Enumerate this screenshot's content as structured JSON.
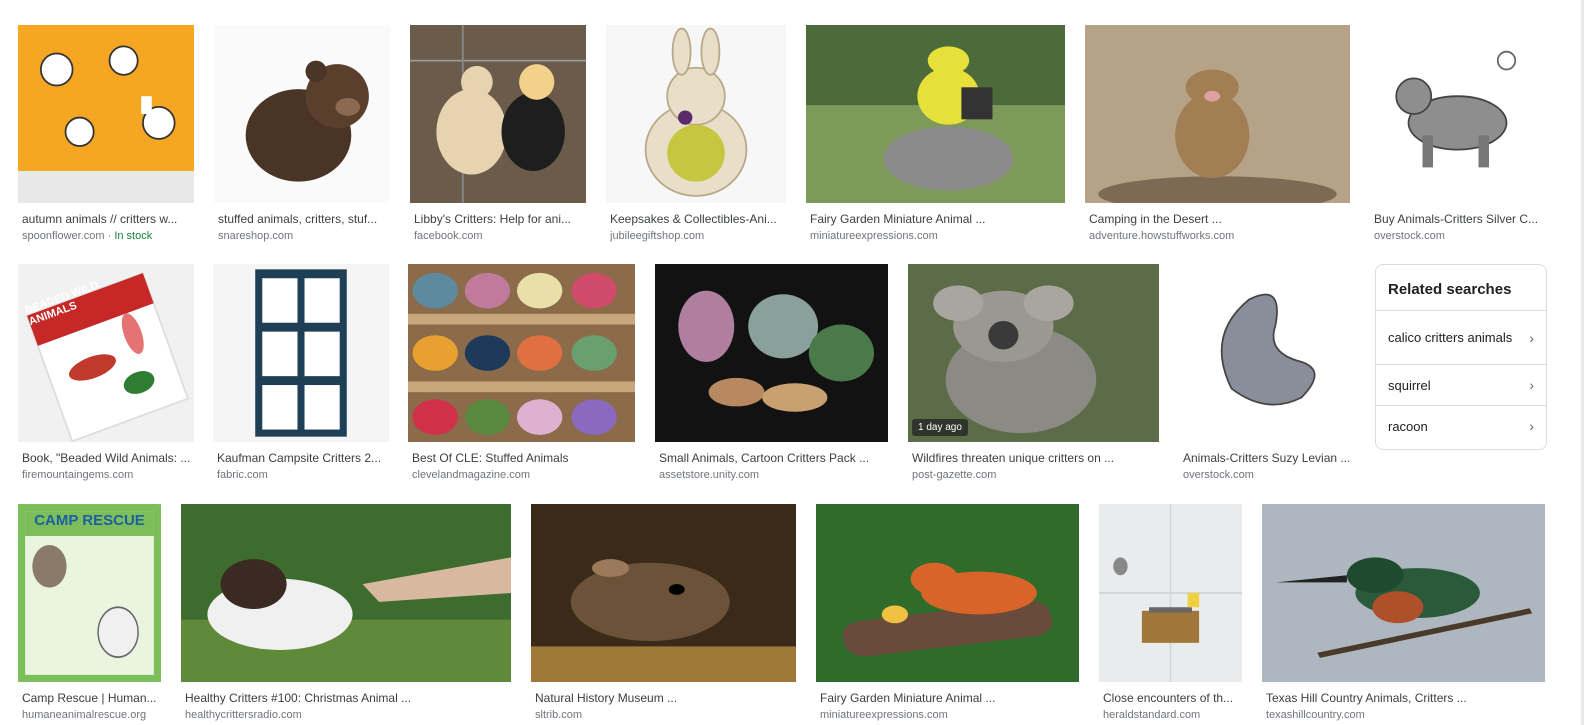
{
  "results": [
    {
      "title": "autumn animals // critters w...",
      "source": "spoonflower.com",
      "stock": "In stock",
      "badge": "",
      "icon": "wallpaper-thumbnail"
    },
    {
      "title": "stuffed animals, critters, stuf...",
      "source": "snareshop.com",
      "badge": "",
      "icon": "teddy-bear-thumbnail"
    },
    {
      "title": "Libby's Critters: Help for ani...",
      "source": "facebook.com",
      "badge": "",
      "icon": "chickens-thumbnail"
    },
    {
      "title": "Keepsakes & Collectibles-Ani...",
      "source": "jubileegiftshop.com",
      "badge": "",
      "icon": "bunny-thumbnail"
    },
    {
      "title": "Fairy Garden Miniature Animal ...",
      "source": "miniatureexpressions.com",
      "badge": "",
      "icon": "goldfinch-thumbnail"
    },
    {
      "title": "Camping in the Desert ...",
      "source": "adventure.howstuffworks.com",
      "badge": "",
      "icon": "prairie-dog-thumbnail"
    },
    {
      "title": "Buy Animals-Critters Silver C...",
      "source": "overstock.com",
      "badge": "",
      "icon": "dog-charm-thumbnail"
    },
    {
      "title": "Book, \"Beaded Wild Animals: ...",
      "source": "firemountaingems.com",
      "badge": "",
      "icon": "book-thumbnail"
    },
    {
      "title": "Kaufman Campsite Critters 2...",
      "source": "fabric.com",
      "badge": "",
      "icon": "fabric-thumbnail"
    },
    {
      "title": "Best Of CLE: Stuffed Animals",
      "source": "clevelandmagazine.com",
      "badge": "",
      "icon": "plush-shelf-thumbnail"
    },
    {
      "title": "Small Animals, Cartoon Critters Pack ...",
      "source": "assetstore.unity.com",
      "badge": "",
      "icon": "cartoon-critters-thumbnail"
    },
    {
      "title": "Wildfires threaten unique critters on ...",
      "source": "post-gazette.com",
      "badge": "1 day ago",
      "icon": "koala-thumbnail"
    },
    {
      "title": "Animals-Critters Suzy Levian ...",
      "source": "overstock.com",
      "badge": "",
      "icon": "swan-brooch-thumbnail"
    },
    {
      "title": "Camp Rescue | Human...",
      "source": "humaneanimalrescue.org",
      "badge": "",
      "icon": "camp-rescue-flyer-thumbnail"
    },
    {
      "title": "Healthy Critters #100: Christmas Animal ...",
      "source": "healthycrittersradio.com",
      "badge": "",
      "icon": "puppy-thumbnail"
    },
    {
      "title": "Natural History Museum ...",
      "source": "sltrib.com",
      "badge": "",
      "icon": "rat-thumbnail"
    },
    {
      "title": "Fairy Garden Miniature Animal ...",
      "source": "miniatureexpressions.com",
      "badge": "",
      "icon": "fox-figurine-thumbnail"
    },
    {
      "title": "Close encounters of th...",
      "source": "heraldstandard.com",
      "badge": "",
      "icon": "mouse-trap-thumbnail"
    },
    {
      "title": "Texas Hill Country Animals, Critters ...",
      "source": "texashillcountry.com",
      "badge": "",
      "icon": "kingfisher-thumbnail"
    }
  ],
  "related": {
    "heading": "Related searches",
    "items": [
      {
        "label": "calico critters animals"
      },
      {
        "label": "squirrel"
      },
      {
        "label": "racoon"
      }
    ]
  },
  "flyer_text": "CAMP RESCUE",
  "book_text": "BEADED WILD ANIMALS",
  "colors": {
    "accent": "#1a73e8",
    "stock": "#188038",
    "border": "#dadce0"
  }
}
